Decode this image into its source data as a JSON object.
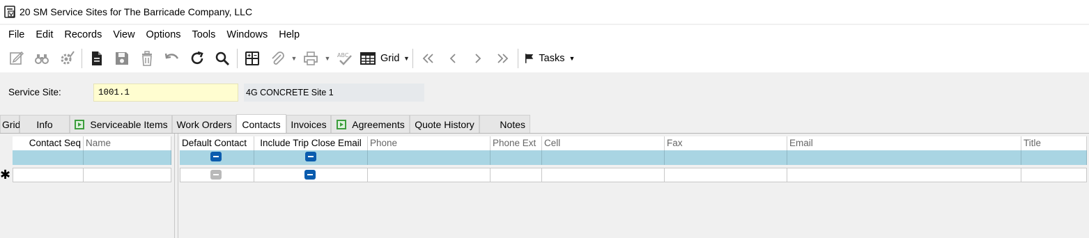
{
  "window": {
    "title": "20 SM Service Sites for The Barricade Company, LLC",
    "icon": "form-icon"
  },
  "menu": [
    "File",
    "Edit",
    "Records",
    "View",
    "Options",
    "Tools",
    "Windows",
    "Help"
  ],
  "toolbar": {
    "grid_label": "Grid",
    "tasks_label": "Tasks",
    "spell_label": "ABC"
  },
  "form": {
    "service_site_label": "Service Site:",
    "service_site_value": "1001.1",
    "service_site_description": "4G CONCRETE Site 1"
  },
  "tabs": [
    {
      "label": "Grid"
    },
    {
      "label": "Info"
    },
    {
      "label": "Serviceable Items",
      "icon": "launch-icon"
    },
    {
      "label": "Work Orders"
    },
    {
      "label": "Contacts",
      "active": true
    },
    {
      "label": "Invoices"
    },
    {
      "label": "Agreements",
      "icon": "launch-icon"
    },
    {
      "label": "Quote History"
    },
    {
      "label": "Notes"
    }
  ],
  "grid": {
    "columns": [
      "Contact Seq",
      "Name",
      "Default Contact",
      "Include Trip Close Email",
      "Phone",
      "Phone Ext",
      "Cell",
      "Fax",
      "Email",
      "Title"
    ],
    "rows": [
      {
        "default_contact": true,
        "include_trip_close_email": true
      }
    ],
    "new_row_marker": "✱",
    "new_row": {
      "default_contact": false,
      "include_trip_close_email": true
    }
  },
  "colors": {
    "selected_row": "#a9d5e3",
    "checkbox_checked": "#0b5cae",
    "site_input_bg": "#fffdd0"
  }
}
